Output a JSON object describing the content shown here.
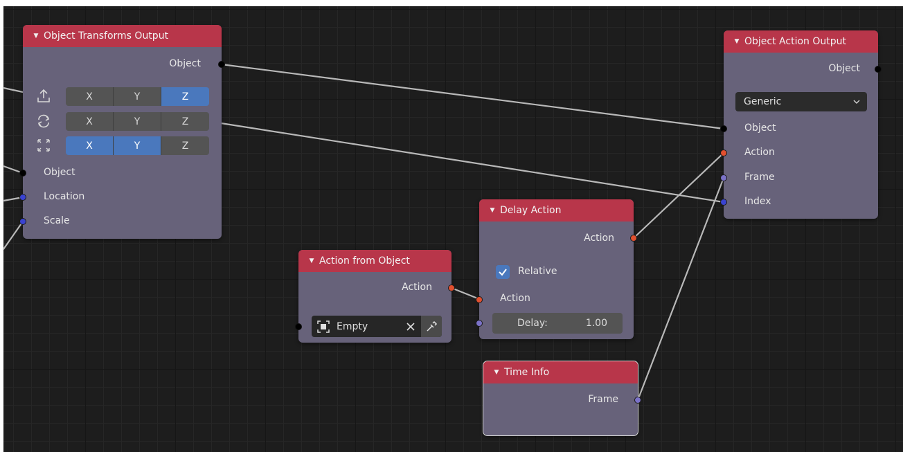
{
  "nodes": {
    "transforms": {
      "title": "Object Transforms Output",
      "output": "Object",
      "rows": [
        {
          "icon": "location-icon",
          "x": "X",
          "y": "Y",
          "z": "Z"
        },
        {
          "icon": "rotation-icon",
          "x": "X",
          "y": "Y",
          "z": "Z"
        },
        {
          "icon": "scale-icon",
          "x": "X",
          "y": "Y",
          "z": "Z"
        }
      ],
      "inputs": [
        "Object",
        "Location",
        "Scale"
      ]
    },
    "action_output": {
      "title": "Object Action Output",
      "output": "Object",
      "mode": "Generic",
      "inputs": [
        "Object",
        "Action",
        "Frame",
        "Index"
      ]
    },
    "delay": {
      "title": "Delay Action",
      "output": "Action",
      "relative_label": "Relative",
      "relative_checked": true,
      "input": "Action",
      "delay_label": "Delay:",
      "delay_value": "1.00"
    },
    "from_object": {
      "title": "Action from Object",
      "output": "Action",
      "object_value": "Empty"
    },
    "time_info": {
      "title": "Time Info",
      "output": "Frame"
    }
  },
  "colors": {
    "header": "#b8364a",
    "node_body": "#67627a",
    "socket_object": "#000000",
    "socket_vector": "#3a43d1",
    "socket_action": "#e2502f",
    "socket_number": "#7b72c8",
    "toggle_on": "#4a78bd"
  }
}
